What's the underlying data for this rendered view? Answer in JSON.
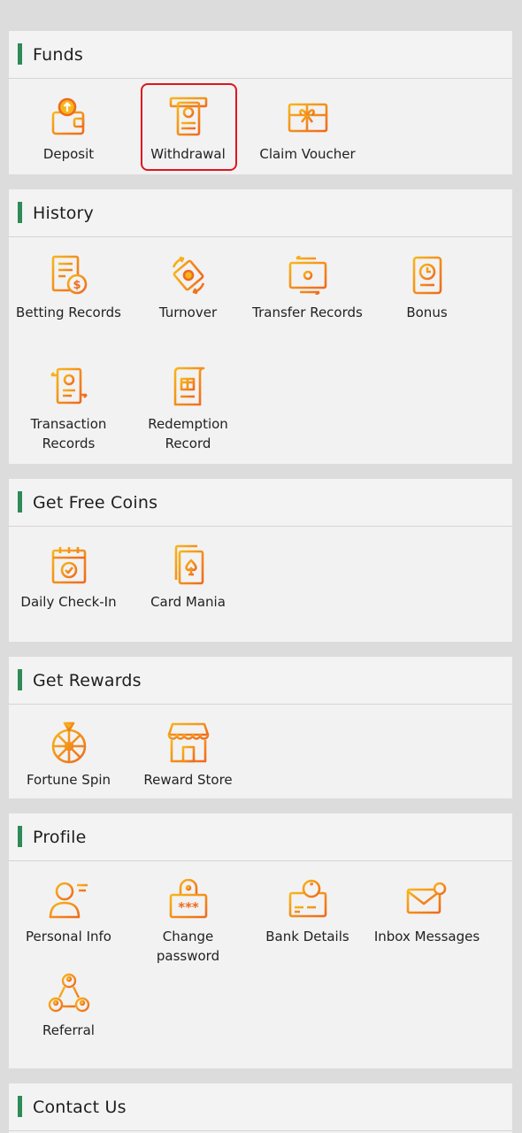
{
  "sections": {
    "funds": {
      "title": "Funds",
      "items": [
        {
          "label": "Deposit",
          "icon": "wallet-deposit-icon"
        },
        {
          "label": "Withdrawal",
          "icon": "atm-withdrawal-icon",
          "selected": true
        },
        {
          "label": "Claim Voucher",
          "icon": "gift-voucher-icon"
        }
      ]
    },
    "history": {
      "title": "History",
      "items": [
        {
          "label": "Betting Records",
          "icon": "betting-records-icon"
        },
        {
          "label": "Turnover",
          "icon": "turnover-icon"
        },
        {
          "label": "Transfer Records",
          "icon": "transfer-records-icon"
        },
        {
          "label": "Bonus",
          "icon": "bonus-icon"
        },
        {
          "label": "Transaction Records",
          "icon": "transaction-records-icon"
        },
        {
          "label": "Redemption Record",
          "icon": "redemption-record-icon"
        }
      ]
    },
    "free_coins": {
      "title": "Get Free Coins",
      "items": [
        {
          "label": "Daily Check-In",
          "icon": "calendar-check-icon"
        },
        {
          "label": "Card Mania",
          "icon": "playing-card-icon"
        }
      ]
    },
    "rewards": {
      "title": "Get Rewards",
      "items": [
        {
          "label": "Fortune Spin",
          "icon": "fortune-wheel-icon"
        },
        {
          "label": "Reward Store",
          "icon": "store-icon"
        }
      ]
    },
    "profile": {
      "title": "Profile",
      "items": [
        {
          "label": "Personal Info",
          "icon": "user-icon"
        },
        {
          "label": "Change password",
          "icon": "lock-password-icon"
        },
        {
          "label": "Bank Details",
          "icon": "bank-card-icon"
        },
        {
          "label": "Inbox Messages",
          "icon": "envelope-icon"
        },
        {
          "label": "Referral",
          "icon": "referral-network-icon"
        }
      ]
    },
    "contact": {
      "title": "Contact Us"
    }
  },
  "colors": {
    "accent_bar": "#2e8b57",
    "icon_orange": "#f07a1a",
    "icon_yellow": "#f6b21b",
    "selected_border": "#e0141f"
  }
}
